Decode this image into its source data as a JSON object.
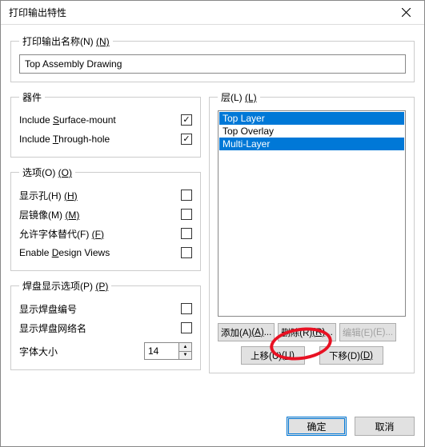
{
  "window": {
    "title": "打印输出特性"
  },
  "nameGroup": {
    "legend_text": "打印输出名称(N) ",
    "legend_acc": "(N)",
    "value": "Top Assembly Drawing"
  },
  "components": {
    "legend": "器件",
    "surface_label_pre": "Include ",
    "surface_label_acc": "S",
    "surface_label_post": "urface-mount",
    "surface_checked": true,
    "through_label_pre": "Include ",
    "through_label_acc": "T",
    "through_label_post": "hrough-hole",
    "through_checked": true
  },
  "options": {
    "legend_text": "选项(O) ",
    "legend_acc": "(O)",
    "holes_label": "显示孔(H) ",
    "holes_acc": "(H)",
    "holes_checked": false,
    "mirror_label": "层镜像(M) ",
    "mirror_acc": "(M)",
    "mirror_checked": false,
    "font_label": "允许字体替代(F) ",
    "font_acc": "(F)",
    "font_checked": false,
    "design_label_pre": "Enable ",
    "design_label_acc": "D",
    "design_label_post": "esign Views",
    "design_checked": false
  },
  "pads": {
    "legend_text": "焊盘显示选项(P) ",
    "legend_acc": "(P)",
    "show_num_label": "显示焊盘编号",
    "show_num_checked": false,
    "show_net_label": "显示焊盘网络名",
    "show_net_checked": false,
    "fontsize_label": "字体大小",
    "fontsize_value": "14"
  },
  "layers": {
    "legend_text": "层(L) ",
    "legend_acc": "(L)",
    "items": [
      {
        "name": "Top Layer",
        "selected": true
      },
      {
        "name": "Top Overlay",
        "selected": false
      },
      {
        "name": "Multi-Layer",
        "selected": true
      }
    ],
    "add_label": "添加(A) ",
    "add_acc": "(A)",
    "add_suffix": "...",
    "remove_label": "删除(R) ",
    "remove_acc": "(R)",
    "remove_suffix": "...",
    "edit_label": "编辑(E) ",
    "edit_acc": "(E)",
    "edit_suffix": "...",
    "moveup_label": "上移(U) ",
    "moveup_acc": "(U)",
    "movedown_label": "下移(D) ",
    "movedown_acc": "(D)"
  },
  "footer": {
    "ok": "确定",
    "cancel": "取消"
  }
}
